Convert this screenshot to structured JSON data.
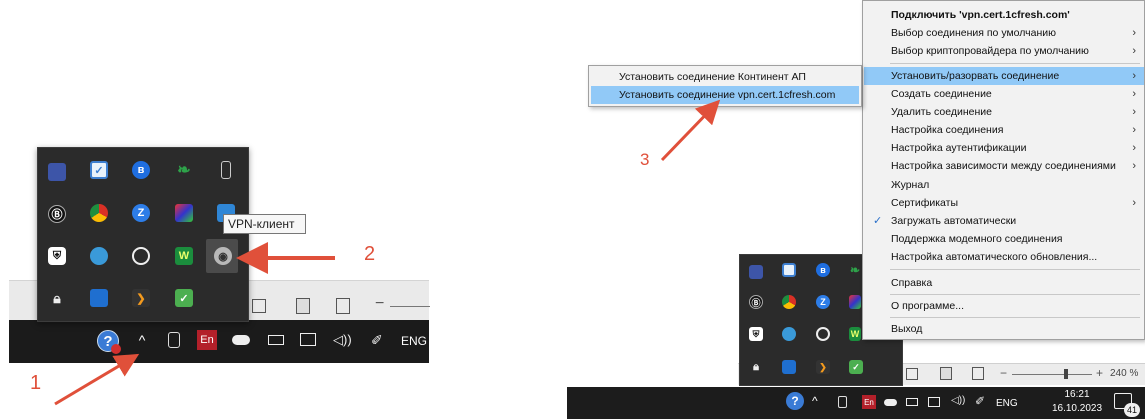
{
  "left": {
    "tooltip": "VPN-клиент",
    "callout_1": "1",
    "callout_2": "2",
    "taskbar": {
      "lang": "ENG",
      "en_badge": "En"
    },
    "tray_icons": [
      "monitor-icon",
      "shield-icon",
      "bluetooth-icon",
      "green-leaf-icon",
      "usb-icon",
      "b-icon",
      "chrome-icon",
      "zoom-icon",
      "photo-icon",
      "display-icon",
      "security-shield-icon",
      "globe-icon",
      "clock-icon",
      "kaspersky-icon",
      "vpn-client-icon",
      "lock-icon",
      "teams-icon",
      "arrow-app-icon",
      "check-app-icon"
    ]
  },
  "right": {
    "callout_3": "3",
    "menu": {
      "items": [
        {
          "label": "Подключить 'vpn.cert.1cfresh.com'",
          "bold": true,
          "arrow": false
        },
        {
          "label": "Выбор соединения по умолчанию",
          "arrow": true
        },
        {
          "label": "Выбор криптопровайдера по умолчанию",
          "arrow": true
        },
        {
          "label": "Установить/разорвать соединение",
          "arrow": true,
          "selected": true
        },
        {
          "label": "Создать соединение",
          "arrow": true
        },
        {
          "label": "Удалить соединение",
          "arrow": true
        },
        {
          "label": "Настройка соединения",
          "arrow": true
        },
        {
          "label": "Настройка аутентификации",
          "arrow": true
        },
        {
          "label": "Настройка зависимости между соединениями",
          "arrow": true
        },
        {
          "label": "Журнал",
          "arrow": false
        },
        {
          "label": "Сертификаты",
          "arrow": true
        },
        {
          "label": "Загружать автоматически",
          "arrow": false,
          "checked": true
        },
        {
          "label": "Поддержка модемного соединения",
          "arrow": false
        },
        {
          "label": "Настройка автоматического обновления...",
          "arrow": false
        },
        {
          "label": "Справка",
          "arrow": false
        },
        {
          "label": "О программе...",
          "arrow": false
        },
        {
          "label": "Выход",
          "arrow": false
        }
      ]
    },
    "submenu": {
      "items": [
        {
          "label": "Установить соединение Континент АП"
        },
        {
          "label": "Установить соединение vpn.cert.1cfresh.com",
          "selected": true
        }
      ]
    },
    "status": {
      "zoom": "240 %"
    },
    "taskbar": {
      "lang": "ENG",
      "time": "16:21",
      "date": "16.10.2023",
      "notifications": "41",
      "en_badge": "En"
    }
  },
  "colors": {
    "accent_selection": "#91c9f7",
    "callout_red": "#e0503a",
    "taskbar_bg": "#1b1b1b"
  }
}
